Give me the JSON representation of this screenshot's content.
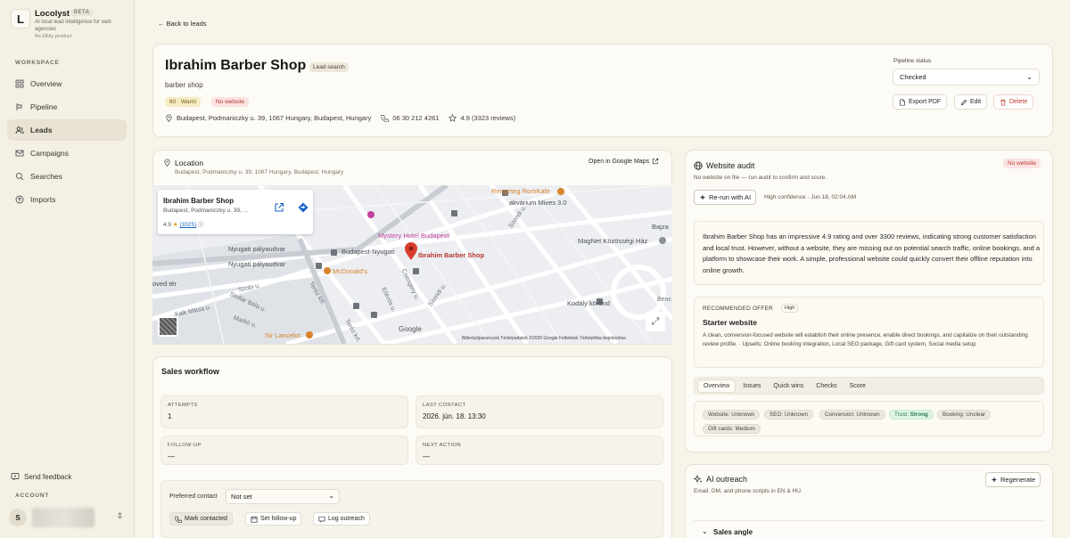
{
  "brand": {
    "logo_letter": "L",
    "name": "Locolyst",
    "badge": "BETA",
    "tagline": "AI local lead intelligence for web agencies",
    "product": "An Elkity product"
  },
  "sidebar": {
    "workspace_label": "WORKSPACE",
    "items": [
      {
        "label": "Overview",
        "icon": "grid-icon"
      },
      {
        "label": "Pipeline",
        "icon": "pipeline-icon"
      },
      {
        "label": "Leads",
        "icon": "users-icon",
        "active": true
      },
      {
        "label": "Campaigns",
        "icon": "mail-icon"
      },
      {
        "label": "Searches",
        "icon": "search-icon"
      },
      {
        "label": "Imports",
        "icon": "upload-icon"
      }
    ],
    "feedback": "Send feedback",
    "account_label": "ACCOUNT",
    "avatar_initial": "S"
  },
  "back_link": "Back to leads",
  "lead": {
    "name": "Ibrahim Barber Shop",
    "source_badge": "Lead search",
    "category": "barber shop",
    "score_badge": "60 · Warm",
    "website_badge": "No website",
    "address": "Budapest, Podmaniczky u. 39, 1067 Hungary, Budapest, Hungary",
    "phone": "06 30 212 4261",
    "rating": "4.9 (3323 reviews)"
  },
  "pipeline": {
    "label": "Pipeline status",
    "value": "Checked"
  },
  "actions": {
    "export": "Export PDF",
    "edit": "Edit",
    "delete": "Delete"
  },
  "location": {
    "title": "Location",
    "address": "Budapest, Podmaniczky u. 39, 1067 Hungary, Budapest, Hungary",
    "open_maps": "Open in Google Maps",
    "map": {
      "info_name": "Ibrahim Barber Shop",
      "info_address": "Budapest, Podmaniczky u. 39, ...",
      "info_rating": "4.9",
      "info_reviews": "(3325)",
      "labels": {
        "rengeteg": "Rengeteg RomKafe",
        "akvarium": "akvárium Mives 3.0",
        "bajza": "Bajza",
        "mystery": "Mystery Hotel Budapest",
        "magnet": "MagNet Közösségi Ház",
        "nyugati1": "Nyugati pályaudvar",
        "bpnyugati": "Budapest-Nyugati",
        "shop": "Ibrahim Barber Shop",
        "nyugati2": "Nyugati pályaudvar",
        "mcd": "McDonald's",
        "oved": "oved tér",
        "kodaly": "Kodály körönd",
        "sirlancelot": "Sir Lancelot",
        "szondi1": "Szondi u.",
        "szondi2": "Szondi u.",
        "csengery": "Csengery u.",
        "eotvos": "Eötvös u.",
        "terez1": "Teréz krt.",
        "terez2": "Teréz krt.",
        "szobi": "Szobi u.",
        "stollar": "Stollár Béla u.",
        "falk": "Falk Miksa u.",
        "marko": "Markó u.",
        "benc": "Benc"
      },
      "google": "Google",
      "attribution": "Billentyűparancsok   Térképadatok ©2025 Google   Feltételek   Térképhiba bejelentése"
    }
  },
  "workflow": {
    "title": "Sales workflow",
    "attempts_label": "ATTEMPTS",
    "attempts": "1",
    "last_contact_label": "LAST CONTACT",
    "last_contact": "2026. jún. 18. 13:30",
    "followup_label": "FOLLOW-UP",
    "followup": "—",
    "next_action_label": "NEXT ACTION",
    "next_action": "—",
    "preferred_label": "Preferred contact",
    "preferred": "Not set",
    "btn_mark": "Mark contacted",
    "btn_follow": "Set follow-up",
    "btn_log": "Log outreach"
  },
  "audit": {
    "title": "Website audit",
    "badge": "No website",
    "sub": "No website on file — run audit to confirm and score.",
    "rerun": "Re-run with AI",
    "confidence": "High confidence · Jun 18, 02:04 AM",
    "summary": "Ibrahim Barber Shop has an impressive 4.9 rating and over 3300 reviews, indicating strong customer satisfaction and local trust. However, without a website, they are missing out on potential search traffic, online bookings, and a platform to showcase their work. A simple, professional website could quickly convert their offline reputation into online growth.",
    "rec_label": "RECOMMENDED OFFER",
    "rec_priority": "High",
    "rec_title": "Starter website",
    "rec_body": "A clean, conversion-focused website will establish their online presence, enable direct bookings, and capitalize on their outstanding review profile. · Upsells: Online booking integration, Local SEO package, Gift card system, Social media setup",
    "tabs": [
      "Overview",
      "Issues",
      "Quick wins",
      "Checks",
      "Score"
    ],
    "chips": [
      {
        "k": "Website:",
        "v": "Unknown"
      },
      {
        "k": "SEO:",
        "v": "Unknown"
      },
      {
        "k": "Conversion:",
        "v": "Unknown"
      },
      {
        "k": "Trust:",
        "v": "Strong"
      },
      {
        "k": "Booking:",
        "v": "Unclear"
      },
      {
        "k": "Gift cards:",
        "v": "Medium"
      }
    ]
  },
  "outreach": {
    "title": "AI outreach",
    "sub": "Email, DM, and phone scripts in EN & HU.",
    "regen": "Regenerate",
    "sales_angle": "Sales angle"
  },
  "colors": {
    "accent_red": "#c0392b",
    "warm": "#f7ecc4",
    "trust_green": "#dff4e6",
    "pin": "#d93c2f"
  }
}
